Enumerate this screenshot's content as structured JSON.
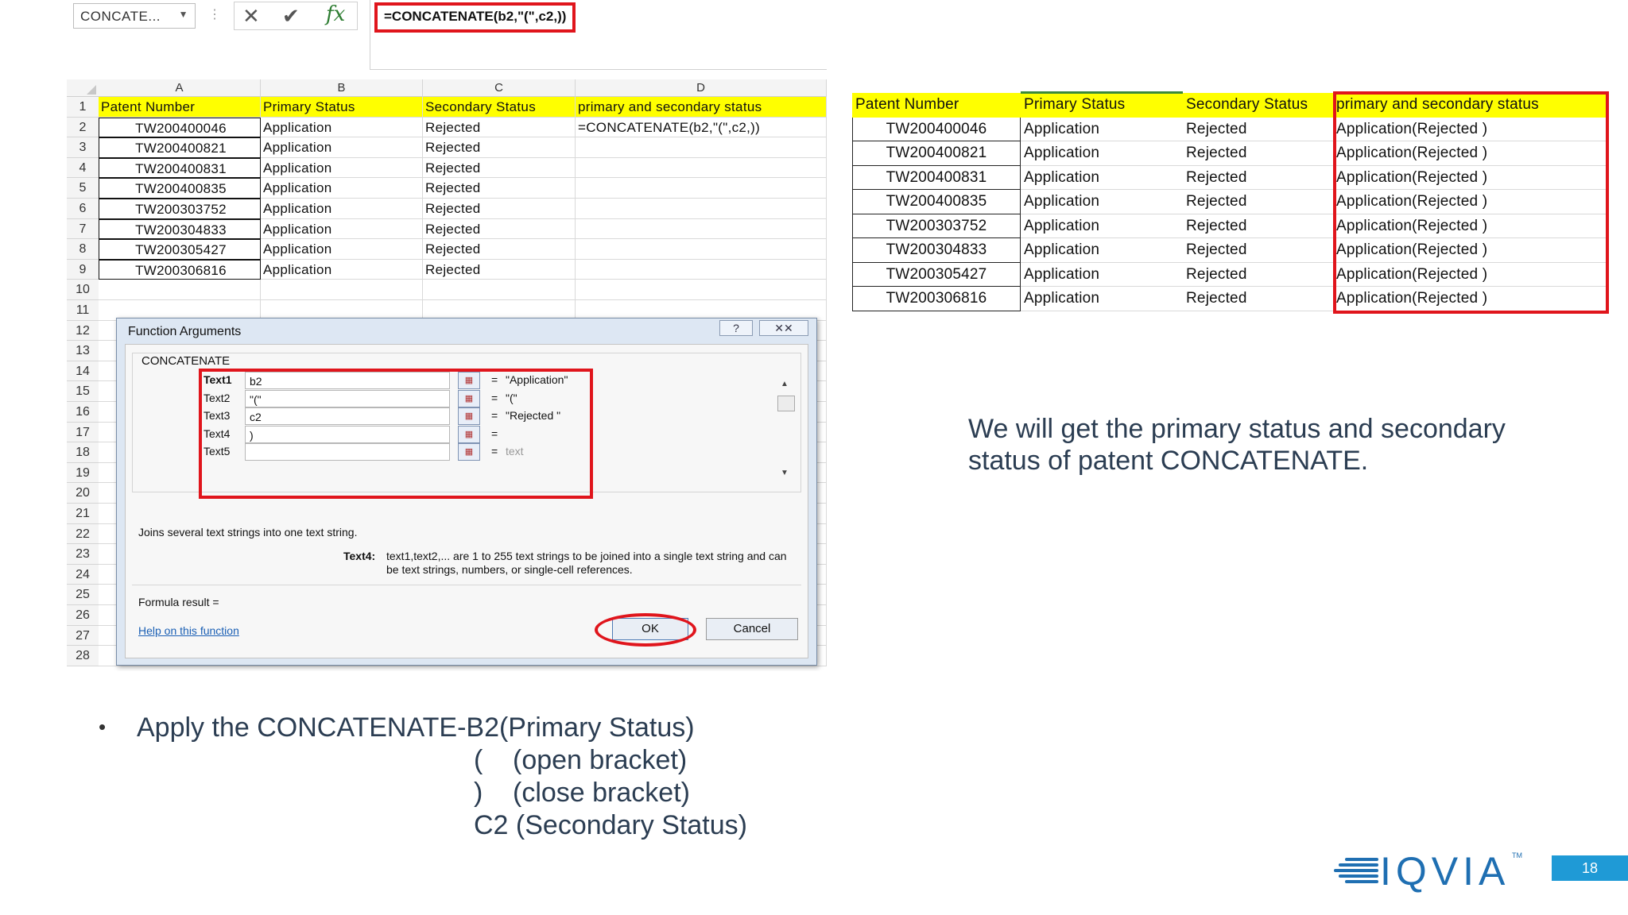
{
  "excel": {
    "name_box": "CONCATE...",
    "formula_bar": "=CONCATENATE(b2,\"(\",c2,))",
    "columns": [
      "A",
      "B",
      "C",
      "D"
    ],
    "row_numbers": [
      "1",
      "2",
      "3",
      "4",
      "5",
      "6",
      "7",
      "8",
      "9",
      "10",
      "11",
      "12",
      "13",
      "14",
      "15",
      "16",
      "17",
      "18",
      "19",
      "20",
      "21",
      "22",
      "23",
      "24",
      "25",
      "26",
      "27",
      "28"
    ],
    "header": {
      "a": "Patent Number",
      "b": "Primary Status",
      "c": "Secondary Status",
      "d": "primary and secondary status"
    },
    "rows": [
      {
        "a": "TW200400046",
        "b": "Application",
        "c": "Rejected",
        "d": "=CONCATENATE(b2,\"(\",c2,))"
      },
      {
        "a": "TW200400821",
        "b": "Application",
        "c": "Rejected",
        "d": ""
      },
      {
        "a": "TW200400831",
        "b": "Application",
        "c": "Rejected",
        "d": ""
      },
      {
        "a": "TW200400835",
        "b": "Application",
        "c": "Rejected",
        "d": ""
      },
      {
        "a": "TW200303752",
        "b": "Application",
        "c": "Rejected",
        "d": ""
      },
      {
        "a": "TW200304833",
        "b": "Application",
        "c": "Rejected",
        "d": ""
      },
      {
        "a": "TW200305427",
        "b": "Application",
        "c": "Rejected",
        "d": ""
      },
      {
        "a": "TW200306816",
        "b": "Application",
        "c": "Rejected",
        "d": ""
      }
    ]
  },
  "dialog": {
    "title": "Function Arguments",
    "help_button": "?",
    "close_button": "✕✕",
    "function_name": "CONCATENATE",
    "args": [
      {
        "label": "Text1",
        "value": "b2",
        "result": "\"Application\""
      },
      {
        "label": "Text2",
        "value": "\"(\"",
        "result": "\"(\""
      },
      {
        "label": "Text3",
        "value": "c2",
        "result": "\"Rejected \""
      },
      {
        "label": "Text4",
        "value": ")",
        "result": ""
      },
      {
        "label": "Text5",
        "value": "",
        "result": "text"
      }
    ],
    "equals": "=",
    "description": "Joins several text strings into one text string.",
    "arg_help_label": "Text4:",
    "arg_help_text": "text1,text2,... are 1 to 255 text strings to be joined into a single text string and can be text strings, numbers, or single-cell references.",
    "formula_result": "Formula result =",
    "help_link": "Help on this function",
    "ok": "OK",
    "cancel": "Cancel"
  },
  "result_table": {
    "header": [
      "Patent Number",
      "Primary Status",
      "Secondary Status",
      "primary and secondary status"
    ],
    "rows": [
      [
        "TW200400046",
        "Application",
        "Rejected",
        "Application(Rejected )"
      ],
      [
        "TW200400821",
        "Application",
        "Rejected",
        "Application(Rejected )"
      ],
      [
        "TW200400831",
        "Application",
        "Rejected",
        "Application(Rejected )"
      ],
      [
        "TW200400835",
        "Application",
        "Rejected",
        "Application(Rejected )"
      ],
      [
        "TW200303752",
        "Application",
        "Rejected",
        "Application(Rejected )"
      ],
      [
        "TW200304833",
        "Application",
        "Rejected",
        "Application(Rejected )"
      ],
      [
        "TW200305427",
        "Application",
        "Rejected",
        "Application(Rejected )"
      ],
      [
        "TW200306816",
        "Application",
        "Rejected",
        "Application(Rejected )"
      ]
    ]
  },
  "text": {
    "right_paragraph": "We will get the primary status and secondary status of patent CONCATENATE.",
    "bullet_line1": "Apply the CONCATENATE-B2(Primary Status)",
    "bullet_line2_symbol": "(",
    "bullet_line2_desc": "(open bracket)",
    "bullet_line3_symbol": ")",
    "bullet_line3_desc": "(close bracket)",
    "bullet_line4": "C2 (Secondary Status)"
  },
  "footer": {
    "logo": "IQVIA",
    "logo_tm": "TM",
    "page_number": "18"
  },
  "colors": {
    "highlight_red": "#e0151c",
    "header_yellow": "#ffff00",
    "brand_blue": "#1f6fb2",
    "text_navy": "#2b3d52"
  }
}
